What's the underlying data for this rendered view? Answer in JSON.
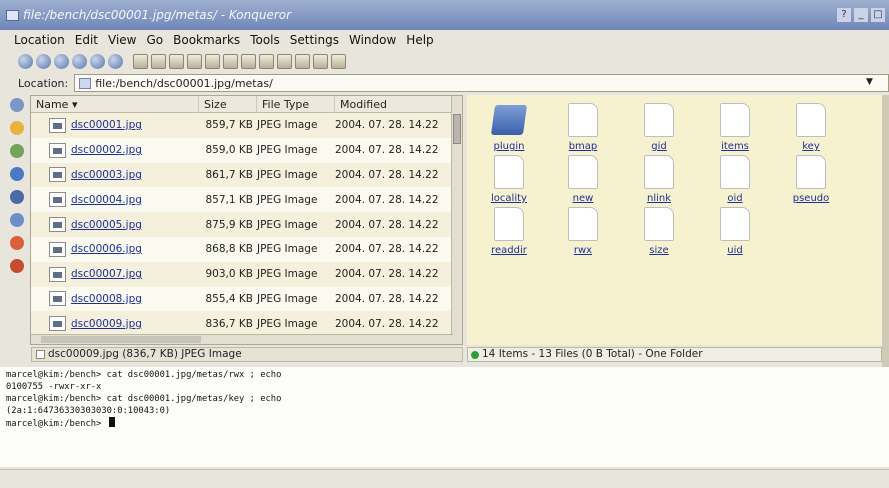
{
  "window": {
    "title": "file:/bench/dsc00001.jpg/metas/ - Konqueror",
    "buttons": [
      "?",
      "_",
      "□"
    ]
  },
  "menu": [
    "Location",
    "Edit",
    "View",
    "Go",
    "Bookmarks",
    "Tools",
    "Settings",
    "Window",
    "Help"
  ],
  "location": {
    "label": "Location:",
    "value": "file:/bench/dsc00001.jpg/metas/"
  },
  "filelist": {
    "columns": [
      "Name",
      "Size",
      "File Type",
      "Modified"
    ],
    "rows": [
      {
        "name": "dsc00001.jpg",
        "size": "859,7 KB",
        "type": "JPEG Image",
        "modified": "2004. 07. 28. 14.22"
      },
      {
        "name": "dsc00002.jpg",
        "size": "859,0 KB",
        "type": "JPEG Image",
        "modified": "2004. 07. 28. 14.22"
      },
      {
        "name": "dsc00003.jpg",
        "size": "861,7 KB",
        "type": "JPEG Image",
        "modified": "2004. 07. 28. 14.22"
      },
      {
        "name": "dsc00004.jpg",
        "size": "857,1 KB",
        "type": "JPEG Image",
        "modified": "2004. 07. 28. 14.22"
      },
      {
        "name": "dsc00005.jpg",
        "size": "875,9 KB",
        "type": "JPEG Image",
        "modified": "2004. 07. 28. 14.22"
      },
      {
        "name": "dsc00006.jpg",
        "size": "868,8 KB",
        "type": "JPEG Image",
        "modified": "2004. 07. 28. 14.22"
      },
      {
        "name": "dsc00007.jpg",
        "size": "903,0 KB",
        "type": "JPEG Image",
        "modified": "2004. 07. 28. 14.22"
      },
      {
        "name": "dsc00008.jpg",
        "size": "855,4 KB",
        "type": "JPEG Image",
        "modified": "2004. 07. 28. 14.22"
      },
      {
        "name": "dsc00009.jpg",
        "size": "836,7 KB",
        "type": "JPEG Image",
        "modified": "2004. 07. 28. 14.22"
      }
    ]
  },
  "iconview": {
    "items": [
      {
        "label": "plugin",
        "kind": "folder"
      },
      {
        "label": "bmap",
        "kind": "file"
      },
      {
        "label": "gid",
        "kind": "file"
      },
      {
        "label": "items",
        "kind": "file"
      },
      {
        "label": "key",
        "kind": "file"
      },
      {
        "label": "locality",
        "kind": "file"
      },
      {
        "label": "new",
        "kind": "file"
      },
      {
        "label": "nlink",
        "kind": "file"
      },
      {
        "label": "oid",
        "kind": "file"
      },
      {
        "label": "pseudo",
        "kind": "file"
      },
      {
        "label": "readdir",
        "kind": "file"
      },
      {
        "label": "rwx",
        "kind": "file"
      },
      {
        "label": "size",
        "kind": "file"
      },
      {
        "label": "uid",
        "kind": "file"
      }
    ]
  },
  "status": {
    "left": "dsc00009.jpg (836,7 KB)  JPEG Image",
    "right": "14 Items - 13 Files (0 B Total) - One Folder"
  },
  "terminal": {
    "lines": [
      "marcel@kim:/bench> cat dsc00001.jpg/metas/rwx ; echo",
      "0100755 -rwxr-xr-x",
      "marcel@kim:/bench> cat dsc00001.jpg/metas/key ; echo",
      "(2a:1:64736330303030:0:10043:0)",
      "marcel@kim:/bench> "
    ]
  },
  "colors": {
    "titlebar": "#7f93c1",
    "iconview_bg": "#f6f2cf",
    "link": "#1d2f9a",
    "status_led": "#2e9e3c"
  }
}
